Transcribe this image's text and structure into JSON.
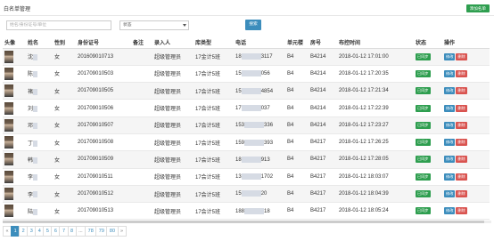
{
  "page": {
    "title": "白名单管理",
    "add_label": "添加名单"
  },
  "search": {
    "placeholder": "姓名/身份证号/单位",
    "status_value": "状态",
    "button_label": "搜索"
  },
  "table": {
    "headers": [
      "头像",
      "姓名",
      "性别",
      "身份证号",
      "备注",
      "录入人",
      "库类型",
      "电话",
      "单元楼",
      "房号",
      "布控时间",
      "状态",
      "操作"
    ],
    "rows": [
      {
        "name": "沈",
        "gender": "女",
        "id_no": "201609010713",
        "remark": "",
        "entry": "超级管理员",
        "lib": "17金计5班",
        "phone_a": "18",
        "phone_b": "3117",
        "building": "B4",
        "room": "B4214",
        "time": "2018-01-12 17:01:00"
      },
      {
        "name": "陈",
        "gender": "女",
        "id_no": "201709010503",
        "remark": "",
        "entry": "超级管理员",
        "lib": "17会计5班",
        "phone_a": "15",
        "phone_b": "056",
        "building": "B4",
        "room": "B4214",
        "time": "2018-01-12 17:20:35"
      },
      {
        "name": "褚",
        "gender": "女",
        "id_no": "201709010505",
        "remark": "",
        "entry": "超级管理员",
        "lib": "17会计5班",
        "phone_a": "15",
        "phone_b": "4854",
        "building": "B4",
        "room": "B4214",
        "time": "2018-01-12 17:21:34"
      },
      {
        "name": "刘",
        "gender": "女",
        "id_no": "201709010506",
        "remark": "",
        "entry": "超级管理员",
        "lib": "17会计5班",
        "phone_a": "17",
        "phone_b": "037",
        "building": "B4",
        "room": "B4214",
        "time": "2018-01-12 17:22:39"
      },
      {
        "name": "邓",
        "gender": "女",
        "id_no": "201709010507",
        "remark": "",
        "entry": "超级管理员",
        "lib": "17会计5班",
        "phone_a": "153",
        "phone_b": "336",
        "building": "B4",
        "room": "B4214",
        "time": "2018-01-12 17:23:27"
      },
      {
        "name": "丁",
        "gender": "女",
        "id_no": "201709010508",
        "remark": "",
        "entry": "超级管理员",
        "lib": "17会计5班",
        "phone_a": "159",
        "phone_b": "393",
        "building": "B4",
        "room": "B4217",
        "time": "2018-01-12 17:26:25"
      },
      {
        "name": "韩",
        "gender": "女",
        "id_no": "201709010509",
        "remark": "",
        "entry": "超级管理员",
        "lib": "17会计5班",
        "phone_a": "18",
        "phone_b": "913",
        "building": "B4",
        "room": "B4217",
        "time": "2018-01-12 17:28:05"
      },
      {
        "name": "李",
        "gender": "女",
        "id_no": "201709010511",
        "remark": "",
        "entry": "超级管理员",
        "lib": "17会计5班",
        "phone_a": "13",
        "phone_b": "1702",
        "building": "B4",
        "room": "B4217",
        "time": "2018-01-12 18:03:07"
      },
      {
        "name": "李",
        "gender": "女",
        "id_no": "201709010512",
        "remark": "",
        "entry": "超级管理员",
        "lib": "17会计5班",
        "phone_a": "15",
        "phone_b": "20",
        "building": "B4",
        "room": "B4217",
        "time": "2018-01-12 18:04:39"
      },
      {
        "name": "陆",
        "gender": "女",
        "id_no": "201709010513",
        "remark": "",
        "entry": "超级管理员",
        "lib": "17会计5班",
        "phone_a": "188",
        "phone_b": "18",
        "building": "B4",
        "room": "B4217",
        "time": "2018-01-12 18:05:24"
      }
    ],
    "status_label": "已同步",
    "edit_label": "修改",
    "delete_label": "删除"
  },
  "pagination": {
    "items": [
      "«",
      "1",
      "2",
      "3",
      "4",
      "5",
      "6",
      "7",
      "8",
      "...",
      "78",
      "79",
      "80",
      "»"
    ],
    "active": "1"
  },
  "colors": {
    "primary": "#3c8dbc",
    "success": "#2e9e4f",
    "danger": "#d9534f"
  }
}
